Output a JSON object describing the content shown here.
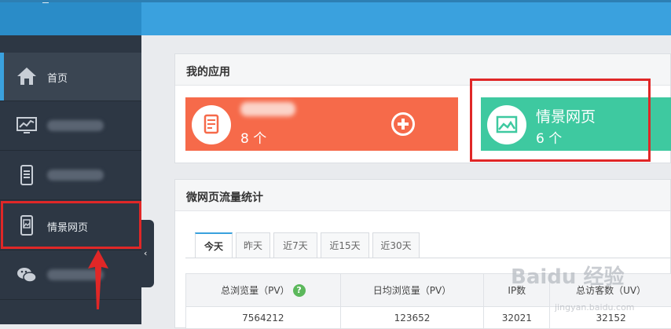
{
  "sidebar": {
    "items": [
      {
        "label": "首页",
        "icon": "home-icon",
        "active": true
      },
      {
        "label": "",
        "icon": "monitor-chart-icon",
        "blurred": true
      },
      {
        "label": "",
        "icon": "phone-icon",
        "blurred": true
      },
      {
        "label": "情景网页",
        "icon": "phone-image-icon",
        "highlighted": true
      },
      {
        "label": "",
        "icon": "wechat-icon",
        "blurred": true
      }
    ],
    "collapse_glyph": "‹"
  },
  "apps_panel": {
    "title": "我的应用",
    "cards": [
      {
        "name": "",
        "count": "8 个",
        "color": "#f66a4a",
        "icon": "document-icon"
      },
      {
        "name": "情景网页",
        "count": "6 个",
        "color": "#3ec9a0",
        "icon": "image-icon"
      }
    ]
  },
  "stats_panel": {
    "title": "微网页流量统计",
    "tabs": [
      "今天",
      "昨天",
      "近7天",
      "近15天",
      "近30天"
    ],
    "active_tab": "今天",
    "columns": [
      "总浏览量（PV）",
      "日均浏览量（PV）",
      "IP数",
      "总访客数（UV）"
    ],
    "rows": [
      [
        "7564212",
        "123652",
        "32021",
        "32152"
      ]
    ],
    "help_glyph": "?"
  },
  "watermark": {
    "text": "Baidu 经验",
    "url": "jingyan.baidu.com"
  },
  "colors": {
    "accent": "#3aa1de",
    "sidebar": "#2d3744",
    "highlight": "#e02727"
  }
}
